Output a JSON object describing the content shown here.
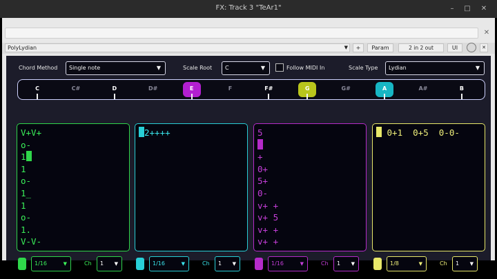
{
  "window": {
    "title": "FX: Track 3 \"TeAr1\"",
    "min": "–",
    "max": "□",
    "close": "✕"
  },
  "host": {
    "close_x": "✕",
    "preset_name": "PolyLydian",
    "plus": "+",
    "param": "Param",
    "io": "2 in 2 out",
    "ui": "UI",
    "x": "✕"
  },
  "controls": {
    "chord_method_label": "Chord Method",
    "chord_method_value": "Single note",
    "scale_root_label": "Scale Root",
    "scale_root_value": "C",
    "follow_midi_label": "Follow MIDI In",
    "scale_type_label": "Scale Type",
    "scale_type_value": "Lydian"
  },
  "notes": [
    {
      "name": "C",
      "active": true
    },
    {
      "name": "C#",
      "active": false
    },
    {
      "name": "D",
      "active": true
    },
    {
      "name": "D#",
      "active": false
    },
    {
      "name": "E",
      "active": true,
      "hl": "#b31fd1"
    },
    {
      "name": "F",
      "active": false
    },
    {
      "name": "F#",
      "active": true
    },
    {
      "name": "G",
      "active": true,
      "hl": "#b9c51c"
    },
    {
      "name": "G#",
      "active": false
    },
    {
      "name": "A",
      "active": true,
      "hl": "#17b6c4"
    },
    {
      "name": "A#",
      "active": false
    },
    {
      "name": "B",
      "active": true
    }
  ],
  "lanes": [
    {
      "color": "#2fd64a",
      "text_color": "#3bf25a",
      "lines": [
        "V+V+",
        "o-",
        "1",
        "1",
        "o-",
        "1_",
        "1",
        "o-",
        "1.",
        "V-V-"
      ],
      "rate": "1/16",
      "ch_label": "Ch",
      "ch": "1"
    },
    {
      "color": "#28cfd6",
      "text_color": "#3ae6ee",
      "lines": [
        "2++++"
      ],
      "rate": "1/16",
      "ch_label": "Ch",
      "ch": "1"
    },
    {
      "color": "#b52bc9",
      "text_color": "#c63fda",
      "lines": [
        "5",
        "",
        "+",
        "0+",
        "5+",
        "0-",
        "v+ +",
        "v+ 5",
        "v+ +",
        "v+ +"
      ],
      "rate": "1/16",
      "ch_label": "Ch",
      "ch": "1"
    },
    {
      "color": "#e8e86a",
      "text_color": "#f0f07a",
      "lines": [
        " 0+1  0+5  0-0-"
      ],
      "rate": "1/8",
      "ch_label": "Ch",
      "ch": "1"
    }
  ]
}
